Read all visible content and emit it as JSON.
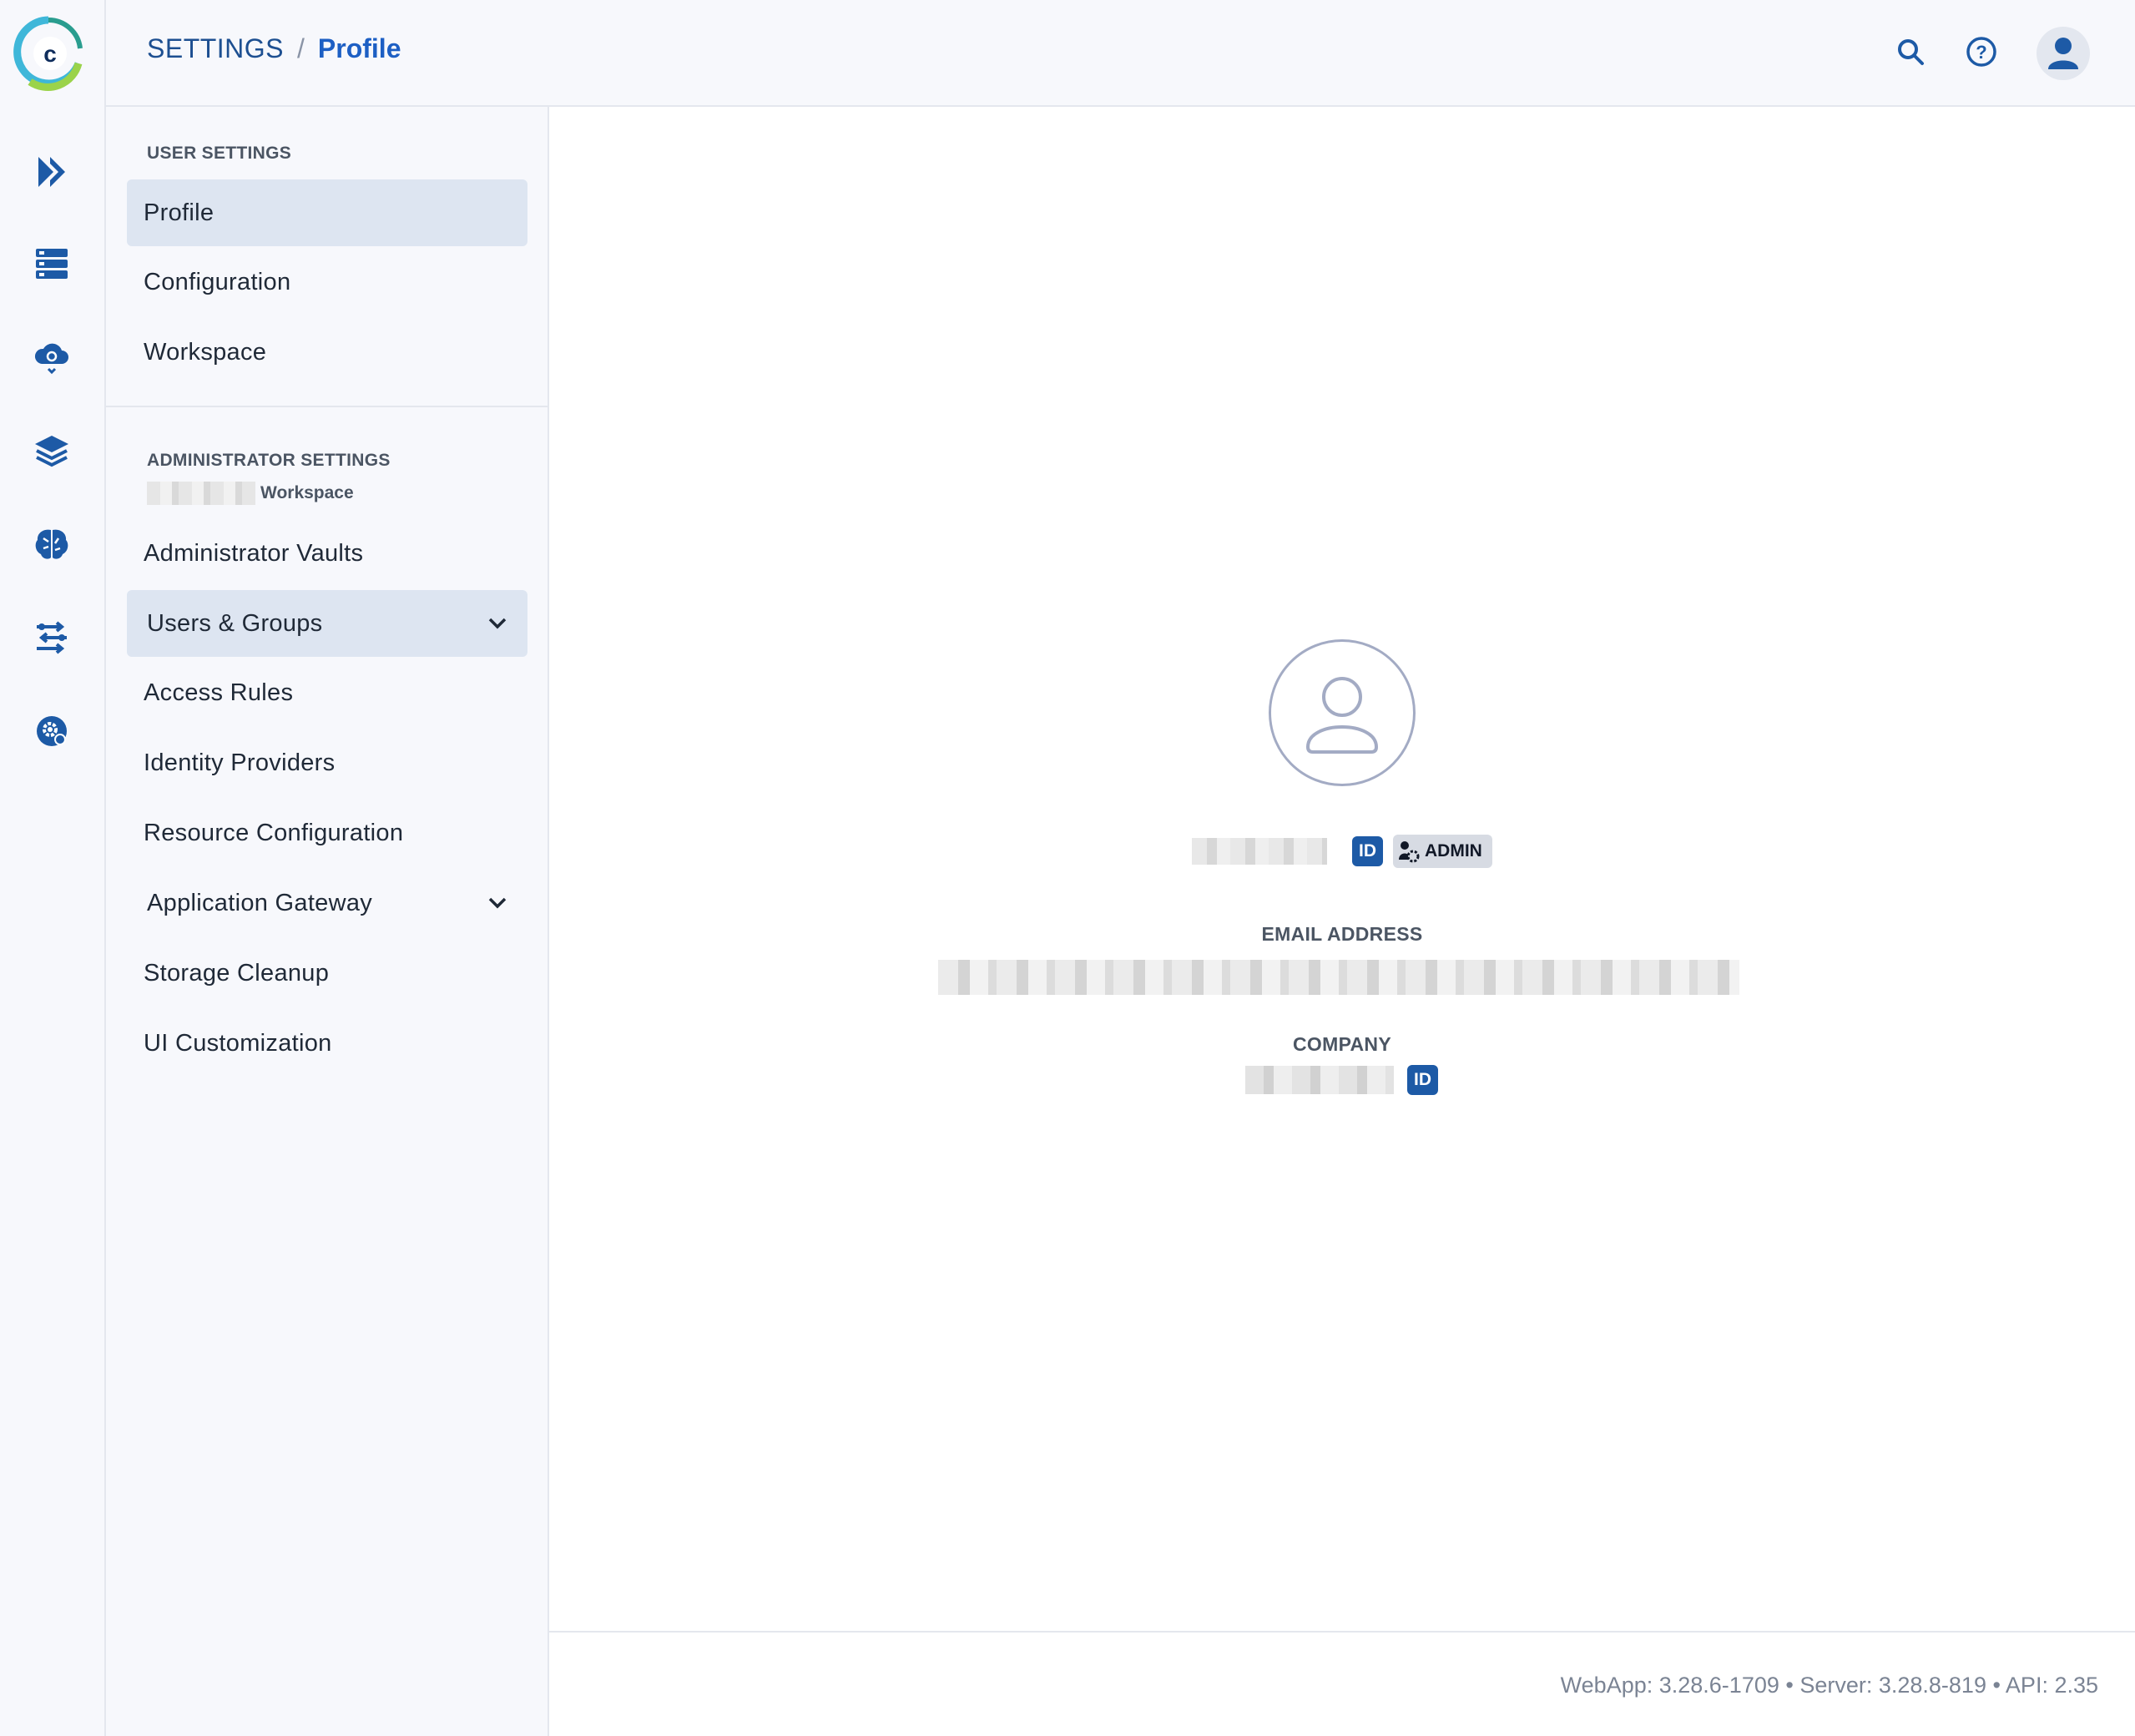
{
  "header": {
    "breadcrumb_root": "SETTINGS",
    "breadcrumb_sep": "/",
    "breadcrumb_current": "Profile",
    "icons": [
      "search-icon",
      "help-icon",
      "user-avatar-icon"
    ]
  },
  "rail": {
    "icons": [
      "pipelines-icon",
      "datasets-icon",
      "cloud-compute-icon",
      "model-layers-icon",
      "brain-icon",
      "orchestration-icon",
      "settings-gear-icon"
    ]
  },
  "sidebar": {
    "user_section_label": "USER SETTINGS",
    "user_items": [
      {
        "label": "Profile",
        "active": true
      },
      {
        "label": "Configuration"
      },
      {
        "label": "Workspace"
      }
    ],
    "admin_section_label": "ADMINISTRATOR SETTINGS",
    "admin_workspace_suffix": "Workspace",
    "admin_items": [
      {
        "label": "Administrator Vaults"
      },
      {
        "label": "Users & Groups",
        "expandable": true,
        "active": true
      },
      {
        "label": "Access Rules"
      },
      {
        "label": "Identity Providers"
      },
      {
        "label": "Resource Configuration"
      },
      {
        "label": "Application Gateway",
        "expandable": true
      },
      {
        "label": "Storage Cleanup"
      },
      {
        "label": "UI Customization"
      }
    ]
  },
  "profile": {
    "id_badge": "ID",
    "role_badge": "ADMIN",
    "email_label": "EMAIL ADDRESS",
    "company_label": "COMPANY",
    "company_id_badge": "ID"
  },
  "footer": {
    "version": "WebApp: 3.28.6-1709 • Server: 3.28.8-819 • API: 2.35"
  },
  "colors": {
    "accent": "#1d5aa6",
    "active_bg": "#dde5f1",
    "badge_admin_bg": "#d7dbe3"
  }
}
